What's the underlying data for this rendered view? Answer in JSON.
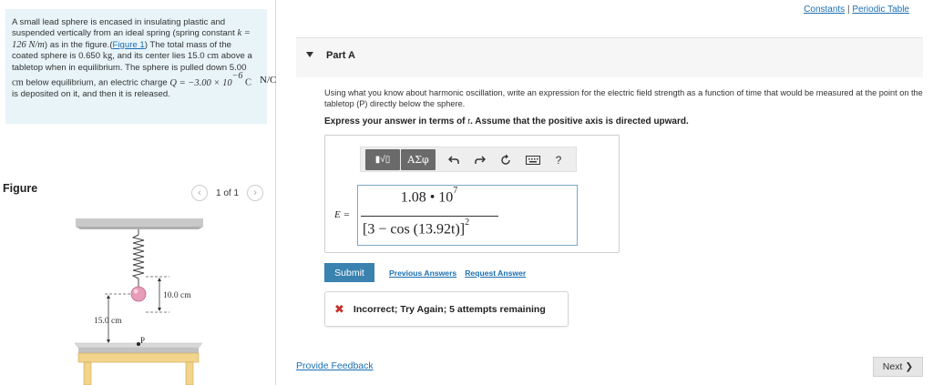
{
  "problem": {
    "text_1": "A small lead sphere is encased in insulating plastic and suspended vertically from an ideal spring (spring constant",
    "k_math": "k = 126 N/m",
    "text_2": ") as in the figure.(",
    "figure_link": "Figure 1",
    "text_3": ") The total mass of the coated sphere is 0.650",
    "mass_unit": "kg",
    "text_4": ", and its center lies 15.0",
    "unit_cm_1": "cm",
    "text_5": "above a tabletop when in equilibrium. The sphere is pulled down 5.00",
    "unit_cm_2": "cm",
    "text_6": "below equilibrium, an electric charge",
    "q_math": "Q = −3.00 × 10",
    "q_exp": "−6",
    "q_unit": "C",
    "text_7": "is deposited on it, and then it is released."
  },
  "figure": {
    "label": "Figure",
    "counter": "1 of 1",
    "prev_icon": "chevron-left-icon",
    "next_icon": "chevron-right-icon",
    "dim_10cm": "10.0 cm",
    "dim_15cm": "15.0 cm",
    "point_label": "P"
  },
  "header": {
    "constants_link": "Constants",
    "separator": "|",
    "periodic_link": "Periodic Table"
  },
  "part": {
    "title": "Part A"
  },
  "question": {
    "text": "Using what you know about harmonic oscillation, write an expression for the electric field strength as a function of time that would be measured at the point on the tabletop (P) directly below the sphere.",
    "instruction_pre": "Express your answer in terms of",
    "instruction_var": "t",
    "instruction_post": ". Assume that the positive axis is directed upward."
  },
  "toolbar": {
    "sqrt_label": "▮√▯",
    "greek_label": "ΑΣφ",
    "undo_icon": "undo-icon",
    "redo_icon": "redo-icon",
    "reset_icon": "reset-icon",
    "keyboard_icon": "keyboard-icon",
    "help_label": "?"
  },
  "answer": {
    "lhs": "E =",
    "numerator": "1.08 • 10",
    "numerator_exp": "7",
    "denominator": "[3 − cos (13.92t)]",
    "denominator_exp": "2",
    "unit": "N/C"
  },
  "actions": {
    "submit": "Submit",
    "previous_answers": "Previous Answers",
    "request_answer": "Request Answer"
  },
  "feedback": {
    "icon": "x-icon",
    "message": "Incorrect; Try Again; 5 attempts remaining",
    "color": "#c8312a"
  },
  "footer": {
    "provide_feedback": "Provide Feedback",
    "next": "Next"
  }
}
